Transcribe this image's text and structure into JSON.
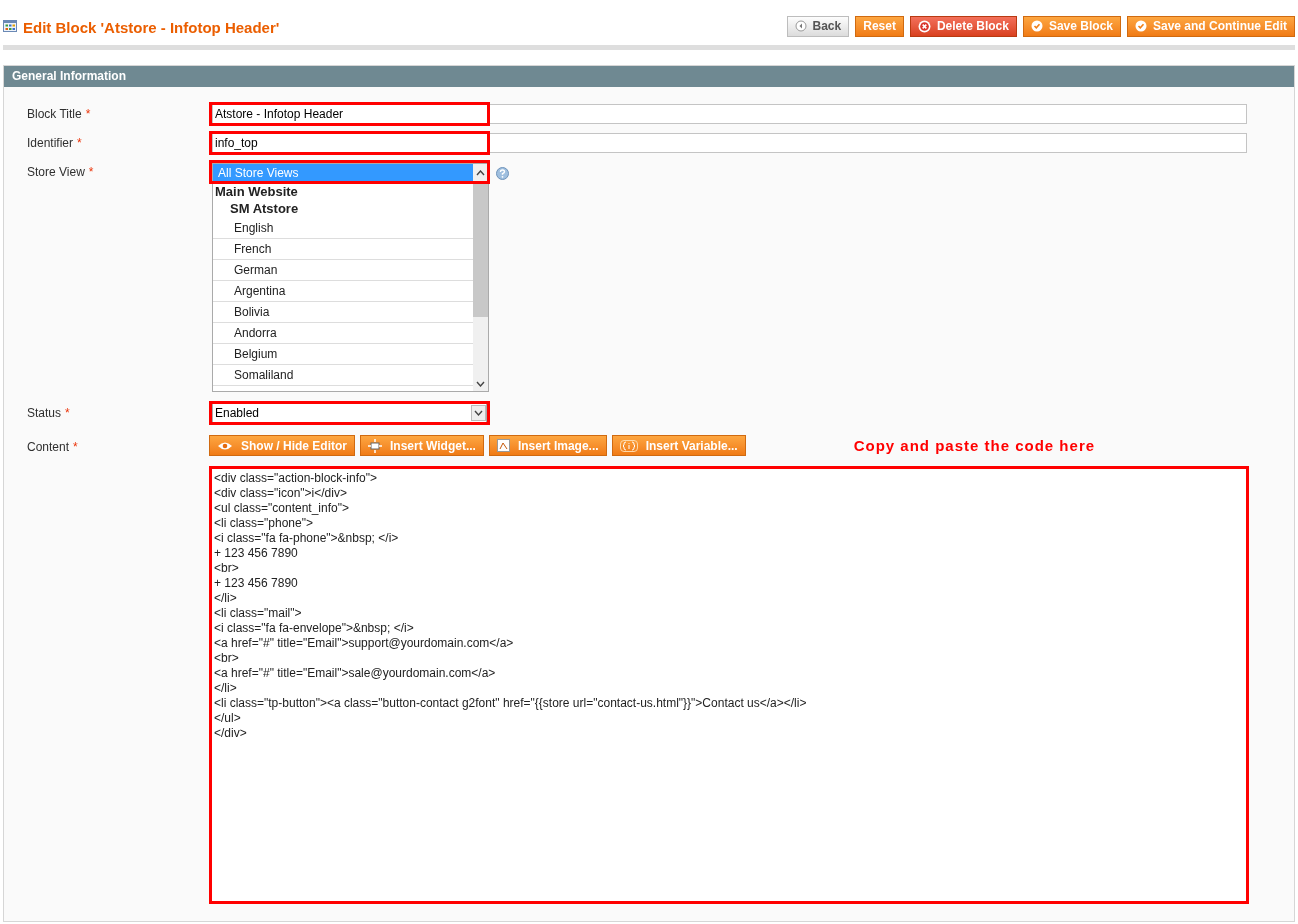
{
  "page_title": "Edit Block 'Atstore - Infotop Header'",
  "buttons": [
    {
      "label": "Back",
      "kind": "back"
    },
    {
      "label": "Reset",
      "kind": "plain"
    },
    {
      "label": "Delete Block",
      "kind": "delete"
    },
    {
      "label": "Save Block",
      "kind": "save"
    },
    {
      "label": "Save and Continue Edit",
      "kind": "save"
    }
  ],
  "section": {
    "title": "General Information"
  },
  "fields": {
    "block_title": {
      "label": "Block Title",
      "required_mark": "*",
      "value": "Atstore - Infotop Header",
      "highlighted": true
    },
    "identifier": {
      "label": "Identifier",
      "required_mark": "*",
      "value": "info_top",
      "highlighted": true
    },
    "store_view": {
      "label": "Store View",
      "required_mark": "*",
      "highlighted": true,
      "options": [
        {
          "label": "All Store Views",
          "kind": "option",
          "selected": true
        },
        {
          "label": "Main Website",
          "kind": "group",
          "selected": false
        },
        {
          "label": "SM Atstore",
          "kind": "subgroup",
          "selected": false
        },
        {
          "label": "English",
          "kind": "option",
          "selected": false
        },
        {
          "label": "French",
          "kind": "option",
          "selected": false
        },
        {
          "label": "German",
          "kind": "option",
          "selected": false
        },
        {
          "label": "Argentina",
          "kind": "option",
          "selected": false
        },
        {
          "label": "Bolivia",
          "kind": "option",
          "selected": false
        },
        {
          "label": "Andorra",
          "kind": "option",
          "selected": false
        },
        {
          "label": "Belgium",
          "kind": "option",
          "selected": false
        },
        {
          "label": "Somaliland",
          "kind": "option",
          "selected": false
        }
      ]
    },
    "status": {
      "label": "Status",
      "required_mark": "*",
      "value": "Enabled",
      "highlighted": true
    },
    "content": {
      "label": "Content",
      "required_mark": "*",
      "highlighted": true,
      "editor_buttons": [
        {
          "label": "Show / Hide Editor",
          "kind": "eye"
        },
        {
          "label": "Insert Widget...",
          "kind": "widget"
        },
        {
          "label": "Insert Image...",
          "kind": "image"
        },
        {
          "label": "Insert Variable...",
          "kind": "variable"
        }
      ],
      "annotation": "Copy and paste the code here",
      "lines": [
        "<div class=\"action-block-info\">",
        "<div class=\"icon\">i</div>",
        "<ul class=\"content_info\">",
        "<li class=\"phone\">",
        "<i class=\"fa fa-phone\">&nbsp; </i>",
        "+ 123 456 7890",
        "<br>",
        "+ 123 456 7890",
        "</li>",
        "<li class=\"mail\">",
        "<i class=\"fa fa-envelope\">&nbsp; </i>",
        "<a href=\"#\" title=\"Email\">support@yourdomain.com</a>",
        "<br>",
        "<a href=\"#\" title=\"Email\">sale@yourdomain.com</a>",
        "</li>",
        "<li class=\"tp-button\"><a class=\"button-contact g2font\" href=\"{{store url=\"contact-us.html\"}}\">Contact us</a></li>",
        "</ul>",
        "</div>"
      ]
    }
  }
}
